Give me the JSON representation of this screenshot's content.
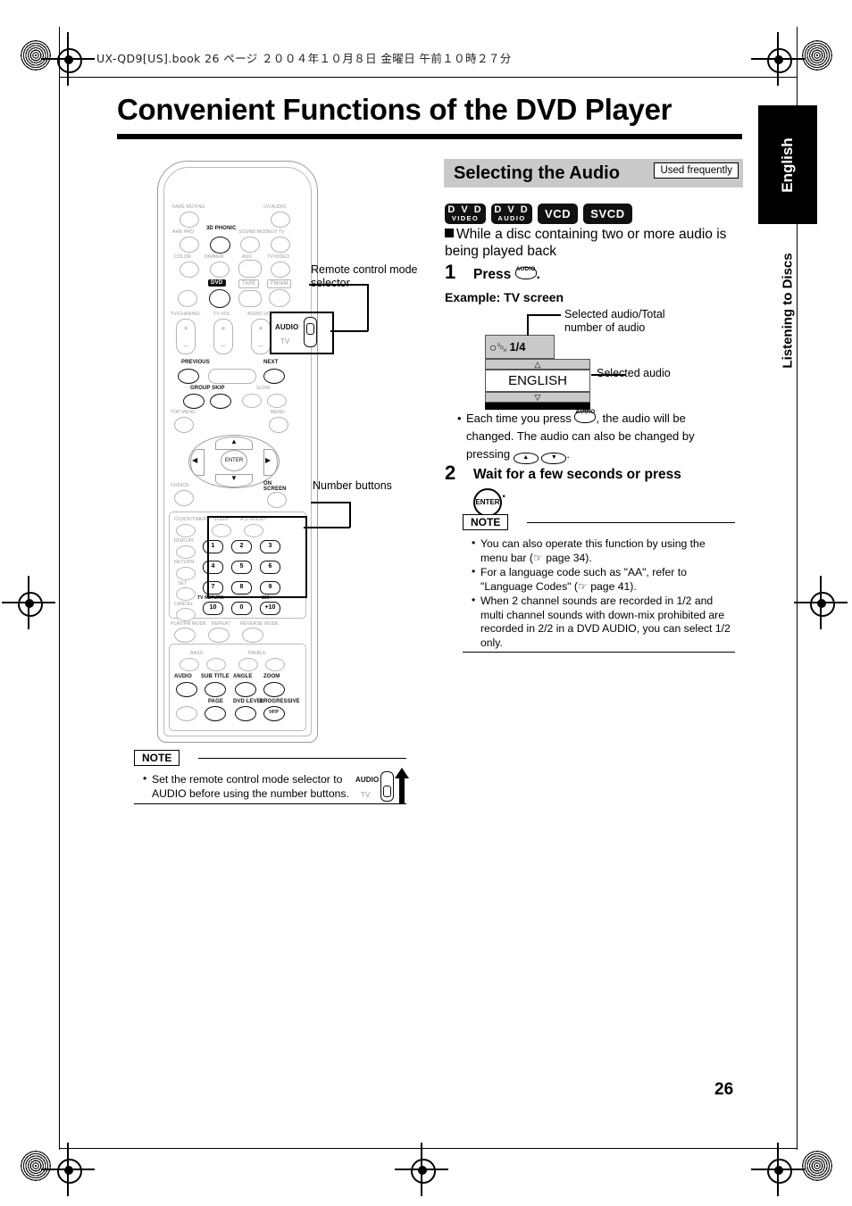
{
  "header": {
    "file_info": "UX-QD9[US].book   26 ページ   ２００４年１０月８日   金曜日   午前１０時２７分"
  },
  "title": "Convenient Functions of the DVD Player",
  "side_tab": {
    "language": "English",
    "section": "Listening to Discs"
  },
  "section": {
    "heading": "Selecting the Audio",
    "badge": "Used frequently",
    "disc_formats": [
      {
        "line1": "D V D",
        "line2": "VIDEO"
      },
      {
        "line1": "D V D",
        "line2": "AUDIO"
      },
      {
        "line1": "VCD",
        "line2": ""
      },
      {
        "line1": "SVCD",
        "line2": ""
      }
    ],
    "subheading": "While a disc containing two or more audio is being played back"
  },
  "steps": [
    {
      "number": "1",
      "text_before": "Press",
      "key_label": "AUDIO",
      "text_after": "."
    },
    {
      "number": "2",
      "text": "Wait for a few seconds or press",
      "key_label": "ENTER",
      "text_after": "."
    }
  ],
  "example": {
    "label": "Example: TV screen",
    "tv_screen": {
      "speaker_icon": "speaker-icon",
      "audio_fraction": "1/4",
      "up_arrow": "△",
      "selected_audio": "ENGLISH",
      "down_arrow": "▽"
    },
    "callout_top": "Selected audio/Total number of audio",
    "callout_right": "Selected audio"
  },
  "step1_note": {
    "part1": "Each time you press",
    "key_label": "AUDIO",
    "part2": ", the audio will be changed. The audio can also be changed by pressing",
    "up_key": "▲",
    "down_key": "▼",
    "part3": "."
  },
  "note_right": {
    "tag": "NOTE",
    "items": [
      "You can also operate this function by using the menu bar (☞ page 34).",
      "For a language code such as \"AA\", refer to \"Language Codes\" (☞ page 41).",
      "When 2 channel sounds are recorded in 1/2 and multi channel sounds with down-mix prohibited are recorded in 2/2 in a DVD AUDIO, you can select 1/2 only."
    ]
  },
  "note_bottom": {
    "tag": "NOTE",
    "text": "Set the remote control mode selector to AUDIO before using the number buttons.",
    "switch": {
      "top": "AUDIO",
      "bottom": "TV"
    }
  },
  "callouts": {
    "mode_selector": "Remote control mode selector",
    "number_buttons": "Number buttons"
  },
  "remote": {
    "mode_switch": {
      "top": "AUDIO",
      "bottom": "TV"
    },
    "labels_row1": [
      "FADE MUTING",
      "⏻/I  AUDIO"
    ],
    "labels_row2": [
      "AHB PRO",
      "3D PHONIC",
      "SOUND MODE",
      "⏻/I TV"
    ],
    "labels_row3": [
      "COLOR",
      "DIMMER",
      "AUX",
      "TV/VIDEO"
    ],
    "labels_row4": [
      "DVD",
      "TAPE",
      "FM/AM"
    ],
    "labels_vol": [
      "TV/CHANNEL",
      "TV VOL",
      "AUDIO VOL"
    ],
    "labels_trans": [
      "PREVIOUS",
      "NEXT",
      "GROUP SKIP",
      "SLOW",
      "TOP MENU",
      "MENU"
    ],
    "nav": {
      "enter": "ENTER",
      "choice": "CHOICE",
      "on_screen": "ON SCREEN"
    },
    "labels_left": [
      "CLOCK/TIMER",
      "SLEEP",
      "A.STANDBY",
      "DISPLAY",
      "RETURN",
      "SET",
      "CANCEL",
      "PLAY/FM MODE",
      "REPEAT",
      "REVERSE MODE"
    ],
    "numbers": [
      "1",
      "2",
      "3",
      "4",
      "5",
      "6",
      "7",
      "8",
      "9",
      "10",
      "0",
      "+10"
    ],
    "number_aux": [
      "TV RETURN",
      "100+"
    ],
    "labels_bottom": [
      "BASS",
      "TREBLE",
      "AUDIO",
      "SUB TITLE",
      "ANGLE",
      "ZOOM",
      "PAGE",
      "DVD LEVEL",
      "PROGRESSIVE",
      "VFP"
    ]
  },
  "page_number": "26"
}
